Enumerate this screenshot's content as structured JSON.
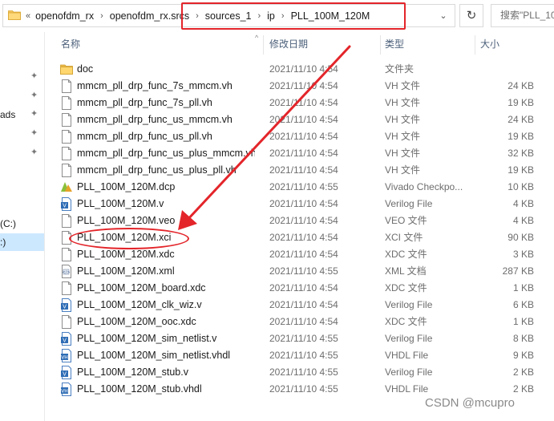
{
  "address": {
    "overflow_glyph": "«",
    "crumbs": [
      "openofdm_rx",
      "openofdm_rx.srcs",
      "sources_1",
      "ip",
      "PLL_100M_120M"
    ],
    "separator": "›",
    "dropdown_glyph": "⌄",
    "refresh_glyph": "↻",
    "search_placeholder": "搜索\"PLL_10"
  },
  "nav": {
    "partial_items": [
      "ads",
      "(C:)",
      ":)"
    ]
  },
  "columns": {
    "name": "名称",
    "date": "修改日期",
    "type": "类型",
    "size": "大小",
    "sort_glyph": "^"
  },
  "files": [
    {
      "name": "doc",
      "date": "2021/11/10 4:54",
      "type": "文件夹",
      "size": "",
      "icon": "folder-icon"
    },
    {
      "name": "mmcm_pll_drp_func_7s_mmcm.vh",
      "date": "2021/11/10 4:54",
      "type": "VH 文件",
      "size": "24 KB",
      "icon": "file-icon"
    },
    {
      "name": "mmcm_pll_drp_func_7s_pll.vh",
      "date": "2021/11/10 4:54",
      "type": "VH 文件",
      "size": "19 KB",
      "icon": "file-icon"
    },
    {
      "name": "mmcm_pll_drp_func_us_mmcm.vh",
      "date": "2021/11/10 4:54",
      "type": "VH 文件",
      "size": "24 KB",
      "icon": "file-icon"
    },
    {
      "name": "mmcm_pll_drp_func_us_pll.vh",
      "date": "2021/11/10 4:54",
      "type": "VH 文件",
      "size": "19 KB",
      "icon": "file-icon"
    },
    {
      "name": "mmcm_pll_drp_func_us_plus_mmcm.vh",
      "date": "2021/11/10 4:54",
      "type": "VH 文件",
      "size": "32 KB",
      "icon": "file-icon"
    },
    {
      "name": "mmcm_pll_drp_func_us_plus_pll.vh",
      "date": "2021/11/10 4:54",
      "type": "VH 文件",
      "size": "19 KB",
      "icon": "file-icon"
    },
    {
      "name": "PLL_100M_120M.dcp",
      "date": "2021/11/10 4:55",
      "type": "Vivado Checkpo...",
      "size": "10 KB",
      "icon": "vivado-checkpoint-icon"
    },
    {
      "name": "PLL_100M_120M.v",
      "date": "2021/11/10 4:54",
      "type": "Verilog File",
      "size": "4 KB",
      "icon": "verilog-file-icon"
    },
    {
      "name": "PLL_100M_120M.veo",
      "date": "2021/11/10 4:54",
      "type": "VEO 文件",
      "size": "4 KB",
      "icon": "file-icon"
    },
    {
      "name": "PLL_100M_120M.xci",
      "date": "2021/11/10 4:54",
      "type": "XCI 文件",
      "size": "90 KB",
      "icon": "file-icon"
    },
    {
      "name": "PLL_100M_120M.xdc",
      "date": "2021/11/10 4:54",
      "type": "XDC 文件",
      "size": "3 KB",
      "icon": "file-icon"
    },
    {
      "name": "PLL_100M_120M.xml",
      "date": "2021/11/10 4:55",
      "type": "XML 文档",
      "size": "287 KB",
      "icon": "xml-document-icon"
    },
    {
      "name": "PLL_100M_120M_board.xdc",
      "date": "2021/11/10 4:54",
      "type": "XDC 文件",
      "size": "1 KB",
      "icon": "file-icon"
    },
    {
      "name": "PLL_100M_120M_clk_wiz.v",
      "date": "2021/11/10 4:54",
      "type": "Verilog File",
      "size": "6 KB",
      "icon": "verilog-file-icon"
    },
    {
      "name": "PLL_100M_120M_ooc.xdc",
      "date": "2021/11/10 4:54",
      "type": "XDC 文件",
      "size": "1 KB",
      "icon": "file-icon"
    },
    {
      "name": "PLL_100M_120M_sim_netlist.v",
      "date": "2021/11/10 4:55",
      "type": "Verilog File",
      "size": "8 KB",
      "icon": "verilog-file-icon"
    },
    {
      "name": "PLL_100M_120M_sim_netlist.vhdl",
      "date": "2021/11/10 4:55",
      "type": "VHDL File",
      "size": "9 KB",
      "icon": "vhdl-file-icon"
    },
    {
      "name": "PLL_100M_120M_stub.v",
      "date": "2021/11/10 4:55",
      "type": "Verilog File",
      "size": "2 KB",
      "icon": "verilog-file-icon"
    },
    {
      "name": "PLL_100M_120M_stub.vhdl",
      "date": "2021/11/10 4:55",
      "type": "VHDL File",
      "size": "2 KB",
      "icon": "vhdl-file-icon"
    }
  ],
  "annotations": {
    "color": "#e3252a",
    "watermark": "CSDN @mcupro"
  }
}
